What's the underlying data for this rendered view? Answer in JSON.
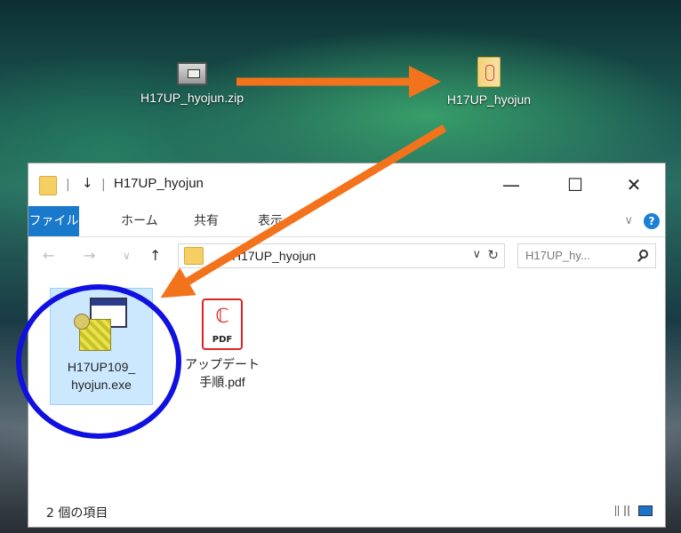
{
  "desktop": {
    "zip_icon": {
      "label": "H17UP_hyojun.zip",
      "icon": "zip-archive-icon"
    },
    "folder_icon": {
      "label": "H17UP_hyojun",
      "icon": "folder-icon"
    }
  },
  "window": {
    "title": "H17UP_hyojun",
    "quick_access_symbol": "↓",
    "controls": {
      "minimize": "—",
      "maximize": "☐",
      "close": "✕"
    },
    "ribbon_tabs": [
      "ファイル",
      "ホーム",
      "共有",
      "表示"
    ],
    "ribbon_expand": "∨",
    "help": "?",
    "nav": {
      "back": "←",
      "forward": "→",
      "recent": "∨",
      "up": "↑"
    },
    "address": {
      "path": "H17UP_hyojun",
      "dropdown": "∨",
      "refresh": "↻"
    },
    "search": {
      "placeholder": "H17UP_hy..."
    },
    "files": [
      {
        "name_line1": "H17UP109_",
        "name_line2": "hyojun.exe",
        "icon": "installer-exe-icon",
        "selected": true
      },
      {
        "name_line1": "アップデート",
        "name_line2": "手順.pdf",
        "icon": "pdf-file-icon",
        "pdf_tag": "PDF",
        "selected": false
      }
    ],
    "status": "2 個の項目"
  },
  "annotations": {
    "arrow_color": "#f2731b",
    "circle_color": "#1010e0"
  }
}
